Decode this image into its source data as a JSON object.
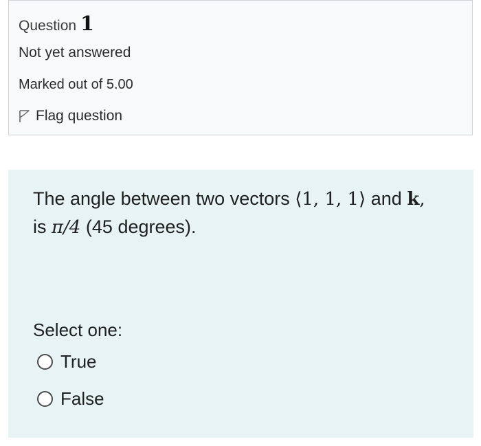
{
  "question": {
    "label": "Question",
    "number": "1",
    "state": "Not yet answered",
    "grade": "Marked out of 5.00",
    "flag_label": "Flag question",
    "flag_icon": "flag-outline-icon"
  },
  "content": {
    "text_intro": "The angle between two vectors",
    "vector": "⟨1, 1, 1⟩",
    "text_and": "and",
    "k": "k",
    "comma": ",",
    "text_is": "is",
    "angle": "π/4",
    "text_degrees": "(45 degrees).",
    "prompt": "Select one:",
    "options": [
      {
        "label": "True",
        "selected": false
      },
      {
        "label": "False",
        "selected": false
      }
    ]
  },
  "colors": {
    "info_bg": "#f8f9fa",
    "info_border": "#cfd3d7",
    "content_bg": "#e7f3f5"
  }
}
